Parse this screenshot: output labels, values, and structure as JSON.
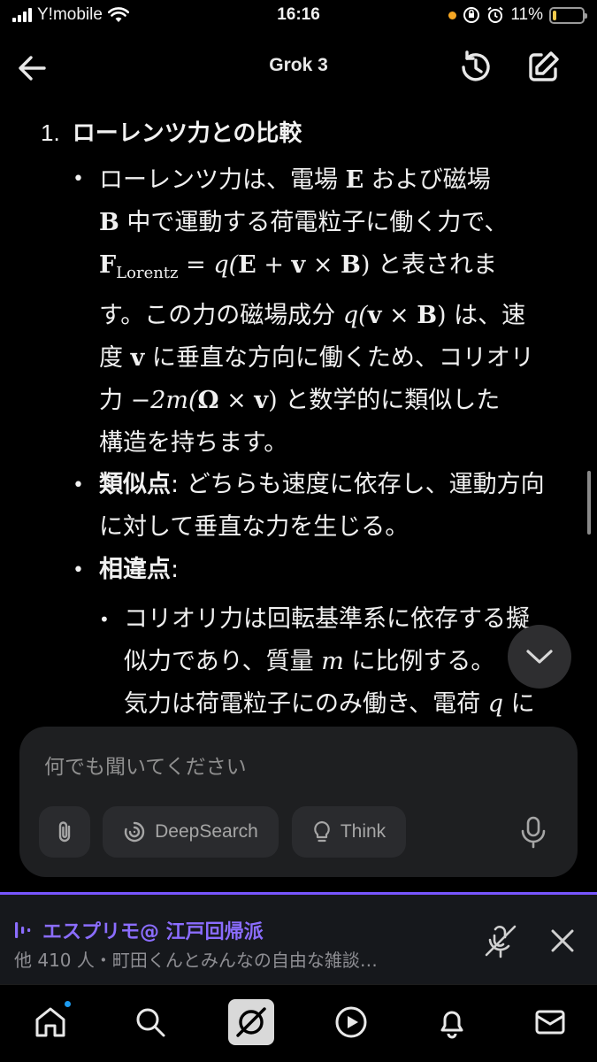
{
  "status_bar": {
    "carrier": "Y!mobile",
    "time": "16:16",
    "battery_percent": "11%",
    "battery_level": 0.11
  },
  "header": {
    "title": "Grok 3"
  },
  "content": {
    "section_number": "1.",
    "section_title": "ローレンツ力との比較",
    "bullet1": {
      "l1_a": "ローレンツ力は、電場 ",
      "E": "E",
      "l1_b": " および磁場",
      "B": "B",
      "l2_a": " 中で運動する荷電粒子に働く力で、",
      "F": "F",
      "F_sub": "Lorentz",
      "eq1": " = q(",
      "eq1_E": "E",
      "eq1_plus": " + ",
      "eq1_v": "v",
      "eq1_x": " × ",
      "eq1_B": "B",
      "eq1_close": ")",
      "l3_tail": " と表されま",
      "l4_a": "す。この力の磁場成分 ",
      "eq2_open": "q(",
      "eq2_v": "v",
      "eq2_x": " × ",
      "eq2_B": "B",
      "eq2_close": ")",
      "l4_b": " は、速",
      "l5_a": "度 ",
      "v": "v",
      "l5_b": " に垂直な方向に働くため、コリオリ",
      "l6_a": "力 ",
      "eq3_a": "−2m(",
      "eq3_omega": "Ω",
      "eq3_x": " × ",
      "eq3_v": "v",
      "eq3_close": ")",
      "l6_b": " と数学的に類似した",
      "l7": "構造を持ちます。"
    },
    "bullet2": {
      "label": "類似点",
      "colon": ": ",
      "text_l1": "どちらも速度に依存し、運動方向",
      "text_l2": "に対して垂直な力を生じる。"
    },
    "bullet3": {
      "label": "相違点",
      "colon": ":"
    },
    "sub_bullet": {
      "l1": "コリオリ力は回転基準系に依存する擬",
      "l2_a": "似力であり、質量 ",
      "m": "m",
      "l2_b": " に比例する。",
      "l3_a": "気力は荷電粒子にのみ働き、電荷 ",
      "q": "q",
      "l3_b": " に"
    }
  },
  "composer": {
    "placeholder": "何でも聞いてください",
    "deepsearch_label": "DeepSearch",
    "think_label": "Think"
  },
  "spaces": {
    "title": "エスプリモ@ 江戸回帰派",
    "subtitle": "他 410 人・町田くんとみんなの自由な雑談…"
  },
  "tabbar": {
    "items": [
      "home-icon",
      "search-icon",
      "grok-icon",
      "play-icon",
      "bell-icon",
      "mail-icon"
    ]
  },
  "colors": {
    "accent_purple": "#7856ff",
    "badge_blue": "#1d9bf0",
    "battery_yellow": "#f2c94c"
  }
}
